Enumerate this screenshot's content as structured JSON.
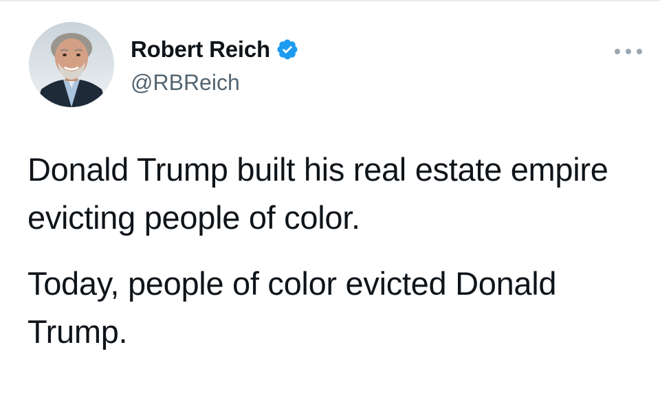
{
  "tweet": {
    "author": {
      "display_name": "Robert Reich",
      "handle": "@RBReich",
      "verified": true
    },
    "paragraphs": [
      "Donald Trump built his real estate empire evicting people of color.",
      "Today, people of color evicted Donald Trump."
    ]
  },
  "icons": {
    "verified": "verified-badge-icon",
    "more": "more-options-icon"
  },
  "colors": {
    "verified_blue": "#1d9bf0",
    "text": "#0f1419",
    "secondary_text": "#536471"
  }
}
